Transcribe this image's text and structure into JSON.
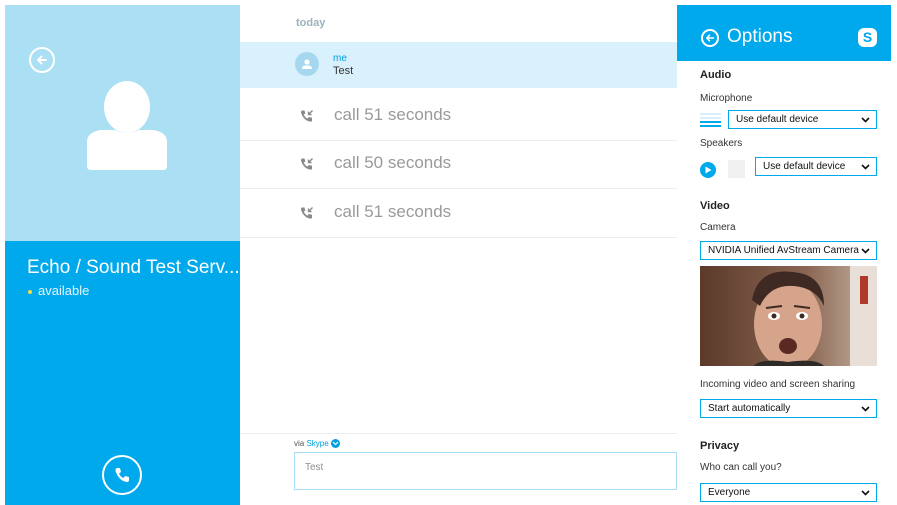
{
  "contact": {
    "name": "Echo / Sound Test Serv...",
    "status": "available"
  },
  "conversation": {
    "day_label": "today",
    "message": {
      "sender": "me",
      "text": "Test"
    },
    "calls": [
      {
        "label": "call 51 seconds"
      },
      {
        "label": "call 50 seconds"
      },
      {
        "label": "call 51 seconds"
      }
    ],
    "via_prefix": "via",
    "via_service": "Skype",
    "compose_value": "Test"
  },
  "options": {
    "title": "Options",
    "logo_letter": "S",
    "audio": {
      "section": "Audio",
      "microphone_label": "Microphone",
      "microphone_value": "Use default device",
      "speakers_label": "Speakers",
      "speakers_value": "Use default device"
    },
    "video": {
      "section": "Video",
      "camera_label": "Camera",
      "camera_value": "NVIDIA Unified AvStream Camera",
      "incoming_label": "Incoming video and screen sharing",
      "incoming_value": "Start automatically"
    },
    "privacy": {
      "section": "Privacy",
      "who_label": "Who can call you?",
      "who_value": "Everyone"
    }
  },
  "colors": {
    "accent": "#00a9ec",
    "photo_bg": "#aadff4",
    "selected_row": "#d9f1fc",
    "status_available": "#fdd84a"
  },
  "icons": [
    "back-arrow-icon",
    "avatar-icon",
    "phone-icon",
    "call-incoming-icon",
    "chevron-down-icon",
    "play-icon",
    "skype-logo-icon"
  ]
}
